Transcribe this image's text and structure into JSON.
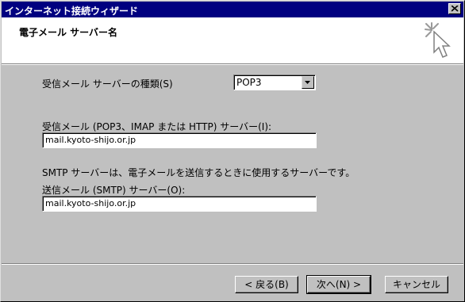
{
  "window": {
    "title": "インターネット接続ウィザード",
    "close_glyph": "×"
  },
  "header": {
    "title": "電子メール サーバー名",
    "icon": "wizard-sparkle-cursor-icon"
  },
  "form": {
    "server_type_label": "受信メール サーバーの種類(S)",
    "server_type_value": "POP3",
    "incoming_label": "受信メール (POP3、IMAP または HTTP) サーバー(I):",
    "incoming_value": "mail.kyoto-shijo.or.jp",
    "smtp_description": "SMTP サーバーは、電子メールを送信するときに使用するサーバーです。",
    "outgoing_label": "送信メール (SMTP) サーバー(O):",
    "outgoing_value": "mail.kyoto-shijo.or.jp"
  },
  "buttons": {
    "back": "< 戻る(B)",
    "next": "次へ(N) >",
    "cancel": "キャンセル"
  },
  "colors": {
    "titlebar": "#000080",
    "face": "#c0c0c0",
    "header_bg": "#ffffff"
  }
}
